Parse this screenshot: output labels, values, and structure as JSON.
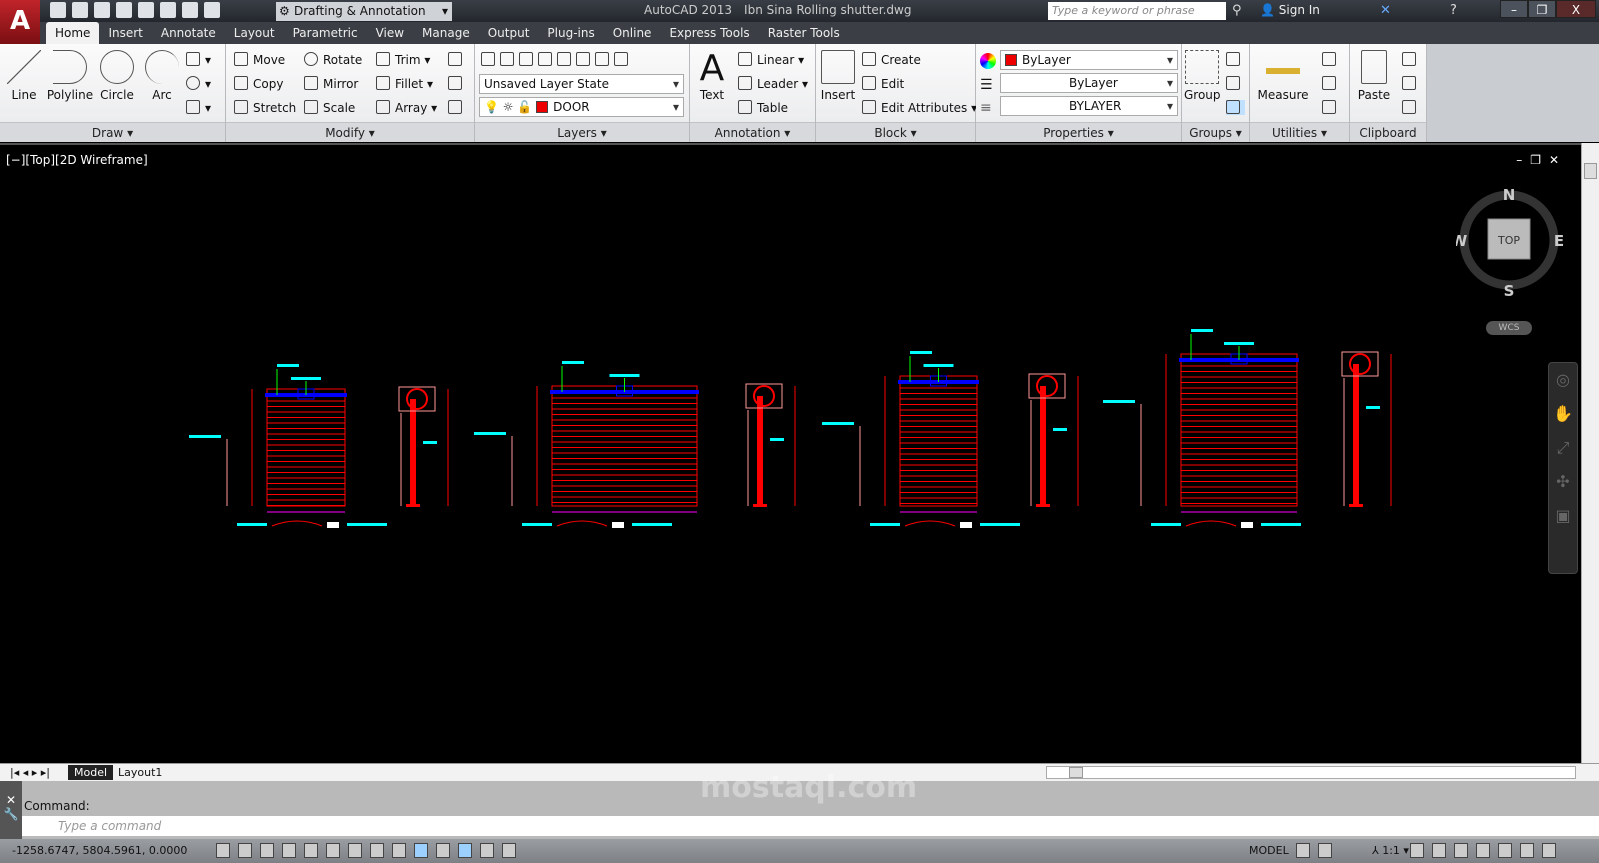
{
  "titlebar": {
    "workspace": "Drafting & Annotation",
    "app_name": "AutoCAD 2013",
    "file_name": "Ibn Sina Rolling shutter.dwg",
    "search_placeholder": "Type a keyword or phrase",
    "sign_in": "Sign In"
  },
  "tabs": [
    "Home",
    "Insert",
    "Annotate",
    "Layout",
    "Parametric",
    "View",
    "Manage",
    "Output",
    "Plug-ins",
    "Online",
    "Express Tools",
    "Raster Tools"
  ],
  "ribbon": {
    "draw": {
      "title": "Draw ▾",
      "line": "Line",
      "polyline": "Polyline",
      "circle": "Circle",
      "arc": "Arc"
    },
    "modify": {
      "title": "Modify ▾",
      "move": "Move",
      "rotate": "Rotate",
      "trim": "Trim",
      "copy": "Copy",
      "mirror": "Mirror",
      "fillet": "Fillet",
      "stretch": "Stretch",
      "scale": "Scale",
      "array": "Array"
    },
    "layers": {
      "title": "Layers ▾",
      "layer_state": "Unsaved Layer State",
      "current_layer": "DOOR"
    },
    "annotation": {
      "title": "Annotation ▾",
      "text": "Text",
      "linear": "Linear",
      "leader": "Leader",
      "table": "Table"
    },
    "block": {
      "title": "Block ▾",
      "insert": "Insert",
      "create": "Create",
      "edit": "Edit",
      "edit_attributes": "Edit Attributes"
    },
    "properties": {
      "title": "Properties ▾",
      "color": "ByLayer",
      "lineweight": "ByLayer",
      "linetype": "BYLAYER"
    },
    "groups": {
      "title": "Groups ▾",
      "group": "Group"
    },
    "utilities": {
      "title": "Utilities ▾",
      "measure": "Measure"
    },
    "clipboard": {
      "title": "Clipboard",
      "paste": "Paste"
    }
  },
  "viewport": {
    "label": "[−][Top][2D Wireframe]",
    "viewcube": {
      "n": "N",
      "s": "S",
      "e": "E",
      "w": "W",
      "face": "TOP"
    },
    "wcs": "WCS"
  },
  "colors": {
    "shutter": "#ff0000",
    "shaft": "#0000ff",
    "text": "#00ffff",
    "dims": "#ff00ff",
    "leader": "#00ff00"
  },
  "layout_tabs": [
    "Model",
    "Layout1"
  ],
  "command": {
    "history": "Command:",
    "placeholder": "Type a command"
  },
  "status": {
    "coords": "-1258.6747, 5804.5961, 0.0000",
    "model": "MODEL",
    "scale": "1:1"
  },
  "watermark": "mostaql.com"
}
